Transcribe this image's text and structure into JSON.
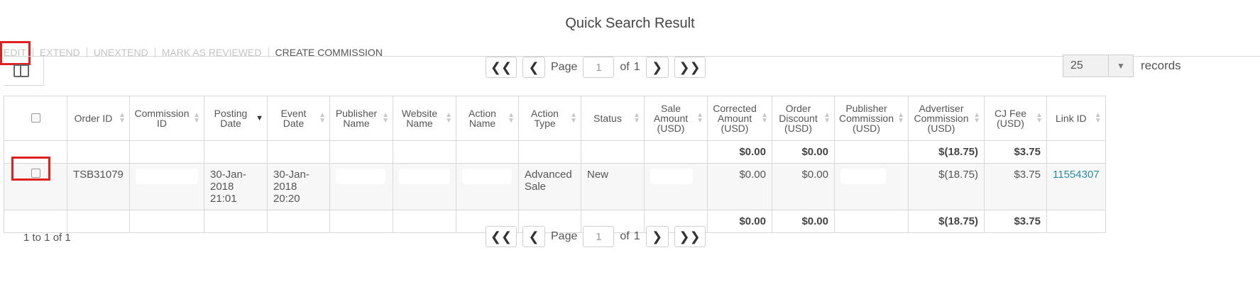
{
  "page": {
    "title": "Quick Search Result"
  },
  "actions": [
    {
      "label": "EDIT",
      "enabled": false
    },
    {
      "label": "EXTEND",
      "enabled": false
    },
    {
      "label": "UNEXTEND",
      "enabled": false
    },
    {
      "label": "MARK AS REVIEWED",
      "enabled": false
    },
    {
      "label": "CREATE COMMISSION",
      "enabled": true
    }
  ],
  "pager": {
    "page_label": "Page",
    "page_value": "1",
    "of_label": "of",
    "total_pages": "1",
    "first_icon": "double-chevron-left",
    "prev_icon": "chevron-left",
    "next_icon": "chevron-right",
    "last_icon": "double-chevron-right"
  },
  "records": {
    "value": "25",
    "label": "records"
  },
  "table": {
    "columns": [
      "Order ID",
      "Commission ID",
      "Posting Date",
      "Event Date",
      "Publisher Name",
      "Website Name",
      "Action Name",
      "Action Type",
      "Status",
      "Sale Amount (USD)",
      "Corrected Amount (USD)",
      "Order Discount (USD)",
      "Publisher Commission (USD)",
      "Advertiser Commission (USD)",
      "CJ Fee (USD)",
      "Link ID"
    ],
    "summary_row": [
      "",
      "",
      "",
      "",
      "",
      "",
      "",
      "",
      "",
      "",
      "$0.00",
      "$0.00",
      "",
      "$(18.75)",
      "$3.75",
      ""
    ],
    "rows": [
      [
        "TSB31079",
        "",
        "30-Jan-2018 21:01",
        "30-Jan-2018 20:20",
        "",
        "",
        "",
        "Advanced Sale",
        "New",
        "",
        "$0.00",
        "$0.00",
        "",
        "$(18.75)",
        "$3.75",
        "11554307"
      ]
    ],
    "total_row": [
      "",
      "",
      "",
      "",
      "",
      "",
      "",
      "",
      "",
      "",
      "$0.00",
      "$0.00",
      "",
      "$(18.75)",
      "$3.75",
      ""
    ]
  },
  "footer": {
    "count_text": "1 to 1 of 1"
  },
  "colors": {
    "highlight": "#e02020",
    "link": "#2a8ca0",
    "disabled": "#c4c4c4"
  }
}
